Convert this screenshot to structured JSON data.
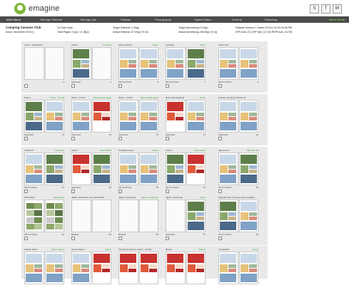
{
  "app": {
    "brand": "emagine"
  },
  "top_buttons": [
    "S",
    "T",
    "W"
  ],
  "nav": {
    "items": [
      "Main Menu",
      "Manage Editorial",
      "Manage Ads",
      "Flatplan",
      "Photography",
      "Digital Edition",
      "General",
      "Reporting"
    ],
    "right_label": "Admin Mode"
  },
  "info": {
    "title": "Camping Caravan Club",
    "issue": "Issue: December 2016 ()",
    "on_sale": "On Sale Date:",
    "total_pages": "Total Pages: 0 (op / 11 (B)p)",
    "target_editorial": "Target Editorial: 0.00pp",
    "actual_editorial": "Actual Editorial: 67.00pp (% ra)",
    "target_advertising": "Target Advertising: 0.00pp",
    "actual_advertising": "Actual Advertising: 38.00pp (% ra)",
    "flatplan_version": "Flatplan Version: 1 Dated 29 Nov 16 02:26:48 PM",
    "dps_ads": "DPS Ads: (0) L/HP Ads: (11.00) R/HP Ads: (11.00)"
  },
  "rows": [
    {
      "cards": [
        {
          "l": "Cover - Inside front",
          "r": "",
          "f1": "",
          "f2": "1",
          "pages": [
            "blank",
            "blank"
          ]
        },
        {
          "l": "Advert",
          "r": "Contents",
          "f1": "Approved",
          "f2": "3",
          "pages": [
            "photo",
            "blank"
          ]
        },
        {
          "l": "Club products",
          "r": "Advert",
          "f1": "OK For Press",
          "f2": "5",
          "pages": [
            "mag",
            "mag"
          ]
        },
        {
          "l": "Contents",
          "r": "Advert",
          "f1": "OK For Press",
          "f2": "7",
          "pages": [
            "mag",
            "photo"
          ]
        },
        {
          "l": "Year in pic",
          "r": "",
          "f1": "OK For Press",
          "f2": "9",
          "pages": [
            "mag",
            "mag"
          ]
        }
      ]
    },
    {
      "cards": [
        {
          "l": "Advert",
          "r": "News - In brief",
          "f1": "Approved",
          "f2": "11",
          "pages": [
            "photo",
            "mag"
          ]
        },
        {
          "l": "News - In brief",
          "r": "News people again",
          "f1": "Approved",
          "f2": "13",
          "pages": [
            "mag",
            "red"
          ]
        },
        {
          "l": "News - In brief",
          "r": "News people again",
          "f1": "Approved",
          "f2": "15",
          "pages": [
            "mag",
            "mag"
          ]
        },
        {
          "l": "News and weekend",
          "r": "Advert",
          "f1": "Approved",
          "f2": "17",
          "pages": [
            "red",
            "mag"
          ]
        },
        {
          "l": "Feature: Camping Stories ad",
          "r": "",
          "f1": "Approved",
          "f2": "19",
          "pages": [
            "mag",
            "mag"
          ]
        }
      ]
    },
    {
      "cards": [
        {
          "l": "Feature 5",
          "r": "Feature 5",
          "f1": "OK For Press",
          "f2": "21",
          "pages": [
            "mag",
            "photo"
          ]
        },
        {
          "l": "Advert",
          "r": "Advert MKS",
          "f1": "Approved",
          "f2": "23",
          "pages": [
            "red",
            "photo"
          ]
        },
        {
          "l": "Campsite travel",
          "r": "Advert",
          "f1": "OK For Press",
          "f2": "25",
          "pages": [
            "mag",
            "mag"
          ]
        },
        {
          "l": "Advert",
          "r": "Ask Lucid 1",
          "f1": "OK For Press",
          "f2": "27",
          "pages": [
            "photo",
            "red"
          ]
        },
        {
          "l": "Ask Lucid 2",
          "r": "Member SS",
          "f1": "OK For Press",
          "f2": "29",
          "pages": [
            "mag",
            "photo"
          ]
        }
      ]
    },
    {
      "cards": [
        {
          "l": "DPS advert",
          "r": "DPS advert",
          "f1": "OK For Press",
          "f2": "31",
          "pages": [
            "grid",
            "grid"
          ]
        },
        {
          "l": "Japan motorhome tour (Find DPS)",
          "r": "",
          "f1": "Booked",
          "f2": "33",
          "pages": [
            "blank",
            "blank"
          ]
        },
        {
          "l": "Japan motorhome",
          "r": "Japan motorhome",
          "f1": "Booked",
          "f2": "35",
          "pages": [
            "blank",
            "blank"
          ]
        },
        {
          "l": "Japan motorhome",
          "r": "Advert",
          "f1": "Approved",
          "f2": "37",
          "pages": [
            "blank",
            "photo"
          ]
        },
        {
          "l": "Special Index: Front gd, wins wedding",
          "r": "",
          "f1": "OK For Press",
          "f2": "39",
          "pages": [
            "photo",
            "mag"
          ]
        }
      ]
    },
    {
      "cards": [
        {
          "l": "Holiday Ideas",
          "r": "How to take it",
          "f1": "",
          "f2": "",
          "pages": [
            "mag",
            "mag"
          ]
        },
        {
          "l": "How to take it",
          "r": "Advert",
          "f1": "",
          "f2": "",
          "pages": [
            "mag",
            "red"
          ]
        },
        {
          "l": "Sample 10 (dinner cooler) - 16 Dec",
          "r": "",
          "f1": "",
          "f2": "",
          "pages": [
            "red",
            "red"
          ]
        },
        {
          "l": "Events",
          "r": "Events",
          "f1": "",
          "f2": "",
          "pages": [
            "red",
            "red"
          ]
        },
        {
          "l": "Competition",
          "r": "Advert",
          "f1": "",
          "f2": "",
          "pages": [
            "mag",
            "mag"
          ]
        }
      ]
    }
  ]
}
